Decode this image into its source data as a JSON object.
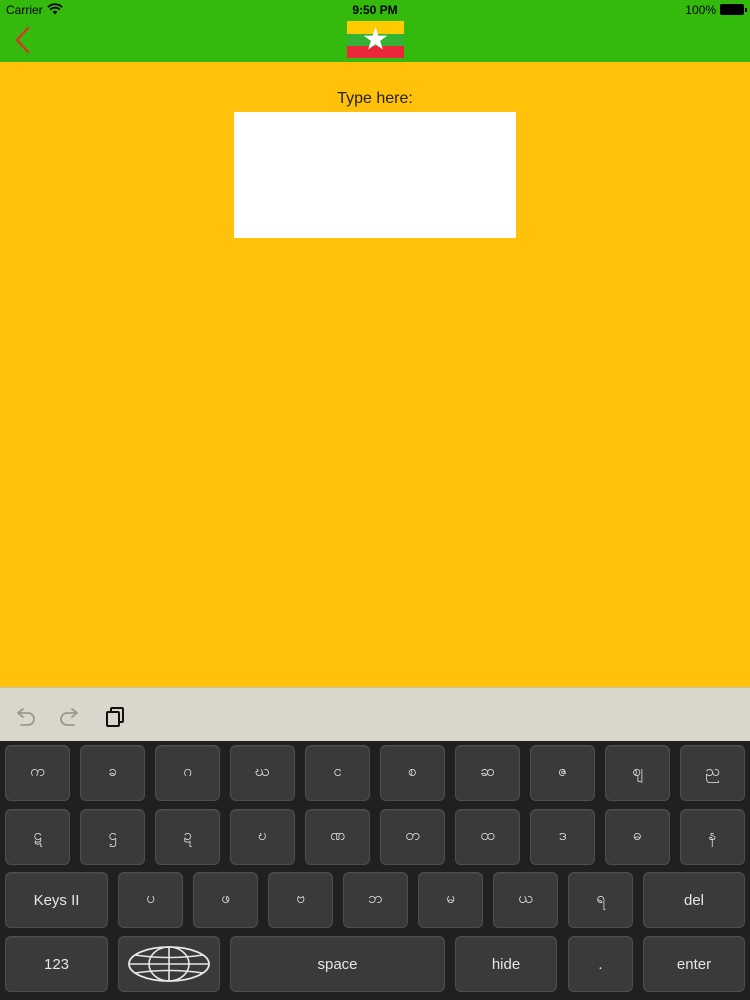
{
  "status": {
    "carrier": "Carrier",
    "time": "9:50 PM",
    "battery": "100%"
  },
  "nav": {
    "back_icon": "chevron-left-icon",
    "flag_icon": "myanmar-flag-icon"
  },
  "editor": {
    "label": "Type here:",
    "value": "",
    "placeholder": ""
  },
  "toolbar": {
    "undo_icon": "undo-icon",
    "redo_icon": "redo-icon",
    "copy_icon": "copy-icon"
  },
  "keyboard": {
    "row1": [
      "က",
      "ခ",
      "ဂ",
      "ဃ",
      "င",
      "စ",
      "ဆ",
      "ဇ",
      "ဈ",
      "ည"
    ],
    "row2": [
      "ဋ",
      "ဌ",
      "ဍ",
      "ဎ",
      "ဏ",
      "တ",
      "ထ",
      "ဒ",
      "ဓ",
      "န"
    ],
    "row3": [
      "ပ",
      "ဖ",
      "ဗ",
      "ဘ",
      "မ",
      "ယ",
      "ရ"
    ],
    "keys2_label": "Keys II",
    "del_label": "del",
    "num_label": "123",
    "globe_icon": "globe-icon",
    "space_label": "space",
    "hide_label": "hide",
    "dot_label": ".",
    "enter_label": "enter"
  },
  "colors": {
    "nav_bg": "#34b90d",
    "page_bg": "#ffc10a",
    "toolbar_bg": "#d9d6cb",
    "keyboard_bg": "#202020",
    "key_bg": "#3a3a3a",
    "back_arrow": "#d9352b"
  }
}
